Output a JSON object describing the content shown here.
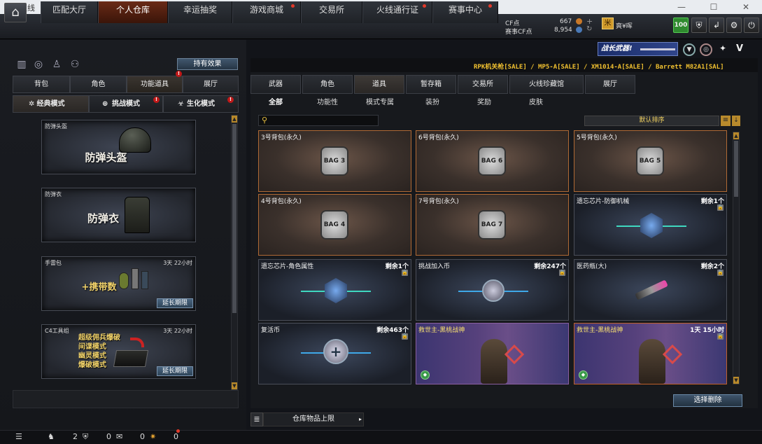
{
  "window": {
    "title": "穿越火线",
    "minimize": "—",
    "maximize": "☐",
    "close": "✕"
  },
  "nav": {
    "home": "⌂",
    "tabs": [
      {
        "label": "匹配大厅"
      },
      {
        "label": "个人仓库"
      },
      {
        "label": "幸运抽奖"
      },
      {
        "label": "游戏商城"
      },
      {
        "label": "交易所"
      },
      {
        "label": "火线通行证"
      },
      {
        "label": "赛事中心"
      }
    ]
  },
  "currency": {
    "cf_label": "CF点",
    "cf_value": "667",
    "sub_label": "赛事CF点",
    "sub_value": "8,954"
  },
  "user": {
    "tag": "爽¥晖",
    "level": "100"
  },
  "left": {
    "hold_effect": "持有效果",
    "tabs": [
      "背包",
      "角色",
      "功能道具",
      "展厅"
    ],
    "modes": [
      "经典模式",
      "挑战模式",
      "生化模式"
    ],
    "items": [
      {
        "name": "防弹头盔",
        "big": "防弹头盔",
        "time": "",
        "ext": ""
      },
      {
        "name": "防弹衣",
        "big": "防弹衣",
        "time": "",
        "ext": ""
      },
      {
        "name": "手雷包",
        "big": "+携带数",
        "time": "3天 22小时",
        "ext": "延长期限"
      },
      {
        "name": "C4工具组",
        "lines": [
          "超级佣兵爆破",
          "间谍模式",
          "幽灵模式",
          "爆破模式"
        ],
        "time": "3天 22小时",
        "ext": "延长期限"
      }
    ]
  },
  "right": {
    "banner": "战长武器!",
    "ticker": "RPK机关枪[SALE] / MP5-A[SALE] / XM1014-A[SALE] / Barrett M82A1[SAL]",
    "tabs": [
      "武器",
      "角色",
      "道具",
      "暂存箱",
      "交易所",
      "火线珍藏馆",
      "展厅"
    ],
    "subtabs": [
      "全部",
      "功能性",
      "模式专属",
      "装扮",
      "奖励",
      "皮肤"
    ],
    "search_placeholder": "",
    "sort": "默认排序",
    "cards": [
      {
        "name": "3号背包(永久)",
        "remain": "",
        "icon": "BAG 3"
      },
      {
        "name": "6号背包(永久)",
        "remain": "",
        "icon": "BAG 6"
      },
      {
        "name": "5号背包(永久)",
        "remain": "",
        "icon": "BAG 5"
      },
      {
        "name": "4号背包(永久)",
        "remain": "",
        "icon": "BAG 4"
      },
      {
        "name": "7号背包(永久)",
        "remain": "",
        "icon": "BAG 7"
      },
      {
        "name": "遗忘芯片-防御机械",
        "remain": "剩余1个",
        "icon": "chip"
      },
      {
        "name": "遗忘芯片-角色属性",
        "remain": "剩余1个",
        "icon": "chip"
      },
      {
        "name": "挑战加入币",
        "remain": "剩余247个",
        "icon": "coin"
      },
      {
        "name": "医药瓶(大)",
        "remain": "剩余2个",
        "icon": "syringe"
      },
      {
        "name": "复活币",
        "remain": "剩余463个",
        "icon": "revive"
      },
      {
        "name": "救世主-黑桃战神",
        "remain": "",
        "icon": "hero"
      },
      {
        "name": "救世主-黑桃战神",
        "remain": "1天 15小时",
        "icon": "hero"
      }
    ],
    "select_delete": "选择删除",
    "capacity": "仓库物品上限"
  },
  "bottom": {
    "count1": "2",
    "count2": "0",
    "count3": "0",
    "count4": "0"
  }
}
